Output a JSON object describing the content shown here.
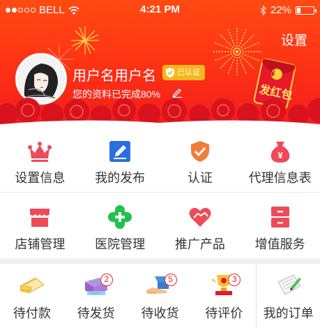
{
  "status_bar": {
    "carrier": "BELL",
    "time": "4:21 PM",
    "battery_percent": "22%",
    "battery_level": 0.22
  },
  "header": {
    "settings_label": "设置",
    "username": "用户名用户名",
    "verified_label": "已认证",
    "profile_completion": "您的资料已完成80%",
    "red_packet_label": "发红包",
    "red_packet_symbol": "¥"
  },
  "colors": {
    "header_red": "#f21c1c",
    "header_orange": "#ff4a12",
    "icon_red": "#ef4a57",
    "icon_blue": "#2a6fe0",
    "icon_orange": "#f47b3a",
    "icon_green": "#21c24a",
    "badge_gold": "#f7b71a"
  },
  "menu_row1": [
    {
      "label": "设置信息",
      "icon": "crown-icon"
    },
    {
      "label": "我的发布",
      "icon": "edit-square-icon"
    },
    {
      "label": "认证",
      "icon": "shield-check-icon"
    },
    {
      "label": "代理信息表",
      "icon": "money-bag-icon"
    }
  ],
  "menu_row2": [
    {
      "label": "店铺管理",
      "icon": "store-icon"
    },
    {
      "label": "医院管理",
      "icon": "medical-cross-icon"
    },
    {
      "label": "推广产品",
      "icon": "heart-handshake-icon"
    },
    {
      "label": "增值服务",
      "icon": "cabinet-icon"
    }
  ],
  "orders": [
    {
      "label": "待付款",
      "icon": "payment-coins-icon",
      "badge": ""
    },
    {
      "label": "待发货",
      "icon": "gift-box-icon",
      "badge": "2"
    },
    {
      "label": "待收货",
      "icon": "delivery-hand-icon",
      "badge": "5"
    },
    {
      "label": "待评价",
      "icon": "rating-trophy-icon",
      "badge": "3"
    },
    {
      "label": "我的订单",
      "icon": "order-document-icon",
      "badge": ""
    }
  ]
}
